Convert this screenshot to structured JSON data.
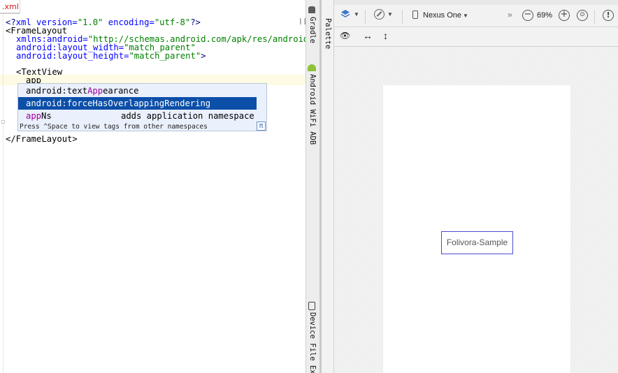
{
  "editor": {
    "tab_label": ".xml",
    "lines": {
      "l1": {
        "a": "<?",
        "b": "xml version=",
        "c": "\"1.0\"",
        "d": " encoding=",
        "e": "\"utf-8\"",
        "f": "?>"
      },
      "l2": "<FrameLayout",
      "l3": {
        "a": "xmlns:android=",
        "b": "\"http://schemas.android.com/apk/res/android\""
      },
      "l4": {
        "a": "android:layout_width=",
        "b": "\"match_parent\""
      },
      "l5": {
        "a": "android:layout_height=",
        "b": "\"match_parent\"",
        "c": ">"
      },
      "l6": "<TextView",
      "l7": "app",
      "l8": "</FrameLayout>"
    }
  },
  "completion": {
    "items": [
      {
        "pre": "android:text",
        "hl": "App",
        "post": "earance"
      },
      {
        "pre": "android:forceHasOverlappingRendering",
        "hl": "",
        "post": ""
      },
      {
        "pre": "",
        "hl": "app",
        "post": "Ns",
        "hint": "adds application namespace"
      }
    ],
    "footer": "Press ^Space to view tags from other namespaces",
    "pi_glyph": "π"
  },
  "side_strip": {
    "gradle": "Gradle",
    "adb": "Android WiFi ADB",
    "device": "Device File Ex"
  },
  "palette": {
    "label": "Palette"
  },
  "toolbar": {
    "device": "Nexus One",
    "collapse_glyph": "»",
    "zoom": "69%",
    "zoom_out": "−",
    "zoom_in": "+",
    "warning": "!"
  },
  "toolbar2": {
    "eye": "👁",
    "h_arrow": "↔",
    "v_arrow": "↕"
  },
  "design": {
    "sample_text": "Folivora-Sample"
  }
}
